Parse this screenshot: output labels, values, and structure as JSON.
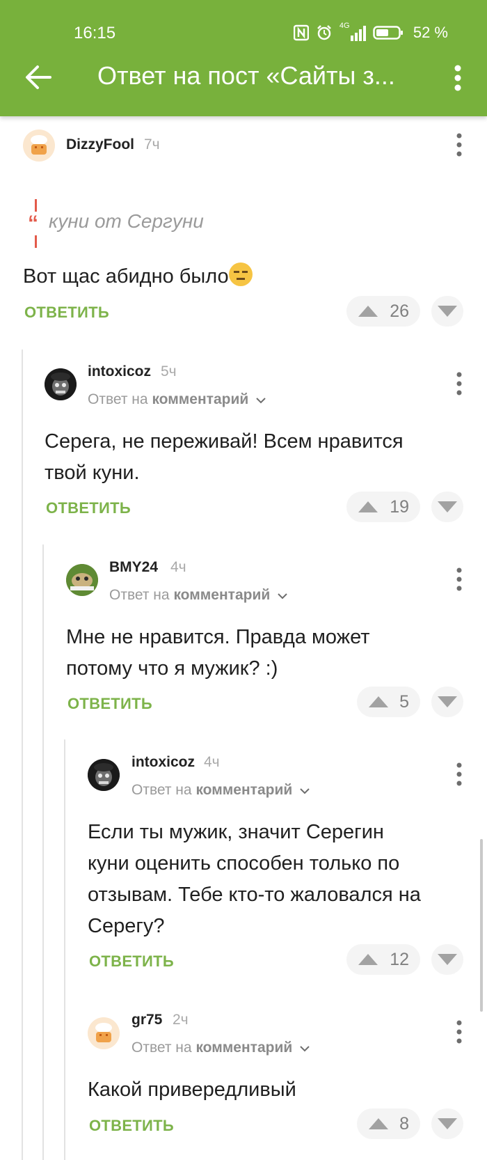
{
  "status_bar": {
    "time": "16:15",
    "network": "4G",
    "battery": "52 %"
  },
  "toolbar": {
    "title": "Ответ на пост «Сайты з...",
    "back_icon": "arrow-back-icon",
    "menu_icon": "more-vert-icon"
  },
  "colors": {
    "header": "#78b13c",
    "accent": "#7db34a",
    "quote": "#e35a4a"
  },
  "comments": [
    {
      "username": "DizzyFool",
      "time": "7ч",
      "quote": "куни от Сергуни",
      "text": "Вот щас абидно было",
      "emoji": "expressionless-face",
      "reply_label": "ОТВЕТИТЬ",
      "rating": "26"
    },
    {
      "username": "intoxicoz",
      "time": "5ч",
      "reply_prefix": "Ответ на",
      "reply_target": "комментарий",
      "text_lines": [
        "Серега, не переживай! Всем нравится",
        "твой куни."
      ],
      "reply_label": "ОТВЕТИТЬ",
      "rating": "19"
    },
    {
      "username": "BMY24",
      "time": "4ч",
      "reply_prefix": "Ответ на",
      "reply_target": "комментарий",
      "text_lines": [
        "Мне не нравится. Правда может",
        "потому что я мужик? :)"
      ],
      "reply_label": "ОТВЕТИТЬ",
      "rating": "5"
    },
    {
      "username": "intoxicoz",
      "time": "4ч",
      "reply_prefix": "Ответ на",
      "reply_target": "комментарий",
      "text_lines": [
        "Если ты мужик, значит Серегин",
        "куни оценить способен только по",
        "отзывам. Тебе кто-то жаловался на",
        "Серегу?"
      ],
      "reply_label": "ОТВЕТИТЬ",
      "rating": "12"
    },
    {
      "username": "gr75",
      "time": "2ч",
      "reply_prefix": "Ответ на",
      "reply_target": "комментарий",
      "text_lines": [
        "Какой привередливый"
      ],
      "reply_label": "ОТВЕТИТЬ",
      "rating": "8"
    }
  ]
}
